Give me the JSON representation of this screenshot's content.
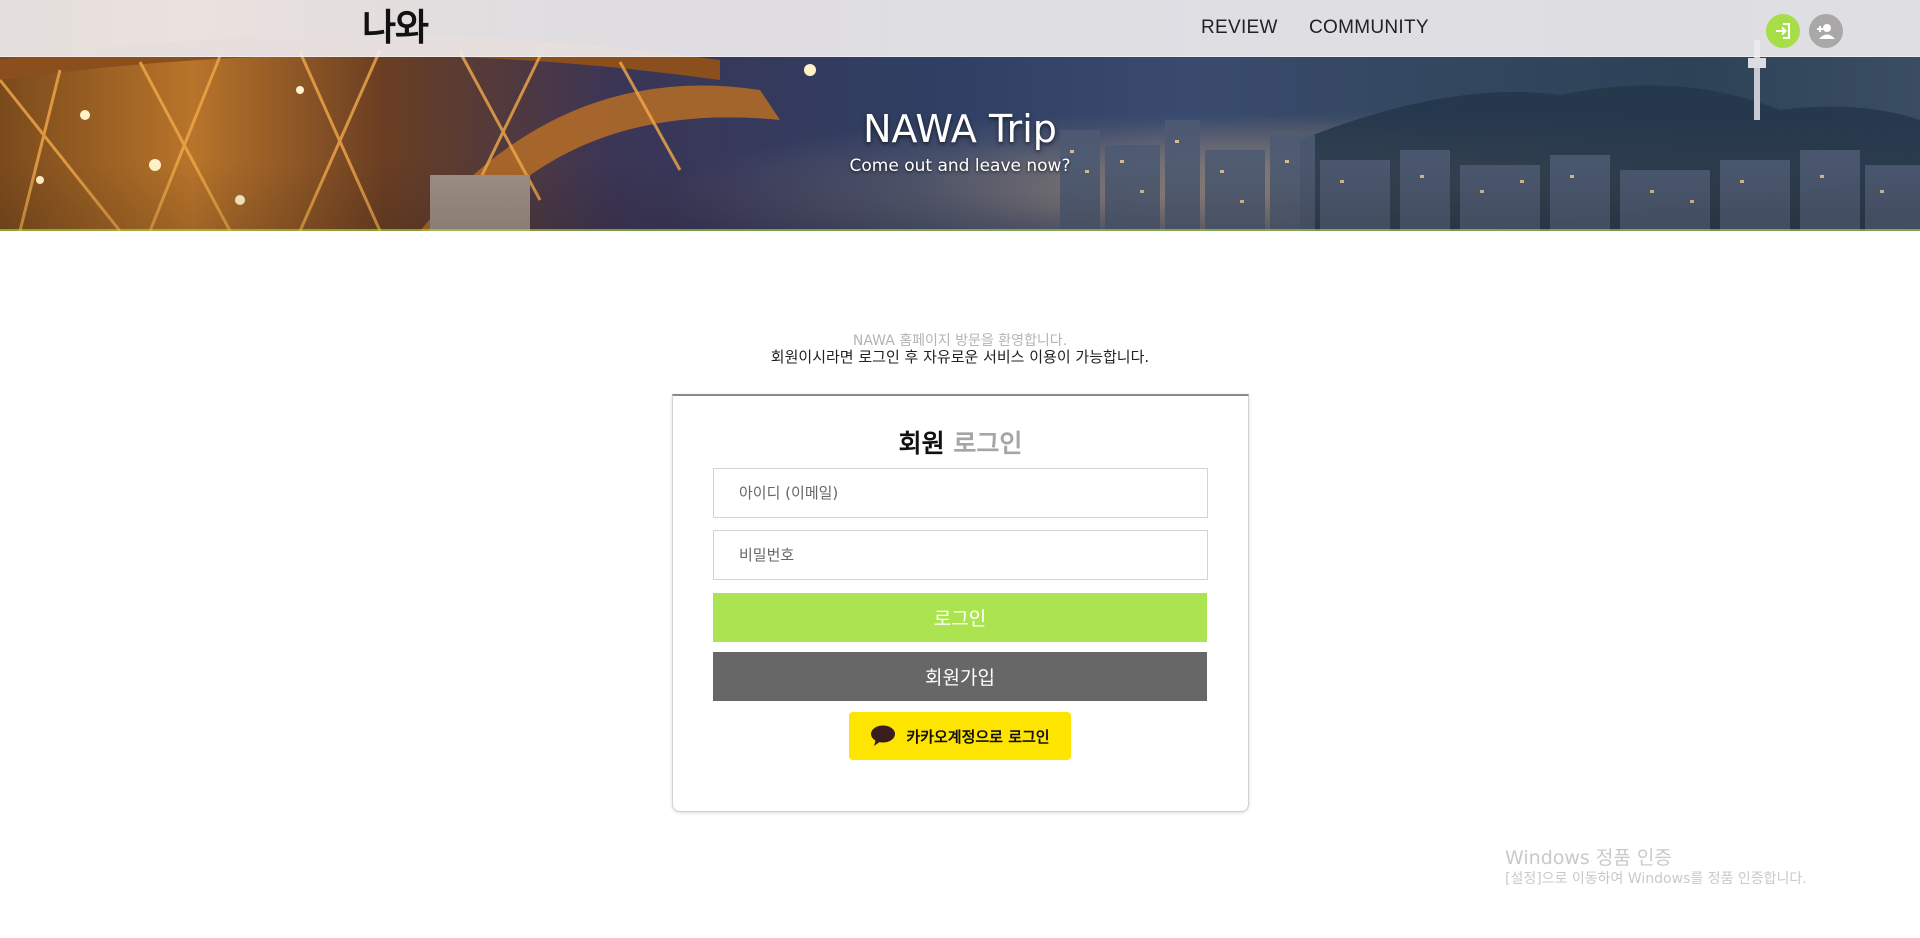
{
  "header": {
    "logo": "나와",
    "nav": [
      {
        "label": "REVIEW"
      },
      {
        "label": "COMMUNITY"
      }
    ],
    "icons": {
      "login": "login-icon",
      "signup": "user-plus-icon"
    },
    "colors": {
      "accent": "#a8dd4a",
      "signup_icon_bg": "#a9a7a7"
    }
  },
  "hero": {
    "title": "NAWA Trip",
    "subtitle": "Come out and leave now?"
  },
  "welcome": {
    "line1": "NAWA 홈페이지 방문을 환영합니다.",
    "line2": "회원이시라면 로그인 후 자유로운 서비스 이용이 가능합니다."
  },
  "login": {
    "title_part1": "회원",
    "title_part2": "로그인",
    "id_placeholder": "아이디 (이메일)",
    "pw_placeholder": "비밀번호",
    "login_button": "로그인",
    "join_button": "회원가입",
    "kakao_button": "카카오계정으로 로그인",
    "kakao_icon": "speech-bubble-icon",
    "colors": {
      "login_btn": "#ace350",
      "join_btn": "#676767",
      "kakao_btn": "#fee500"
    }
  },
  "watermark": {
    "line1": "Windows 정품 인증",
    "line2": "[설정]으로 이동하여 Windows를 정품 인증합니다."
  }
}
